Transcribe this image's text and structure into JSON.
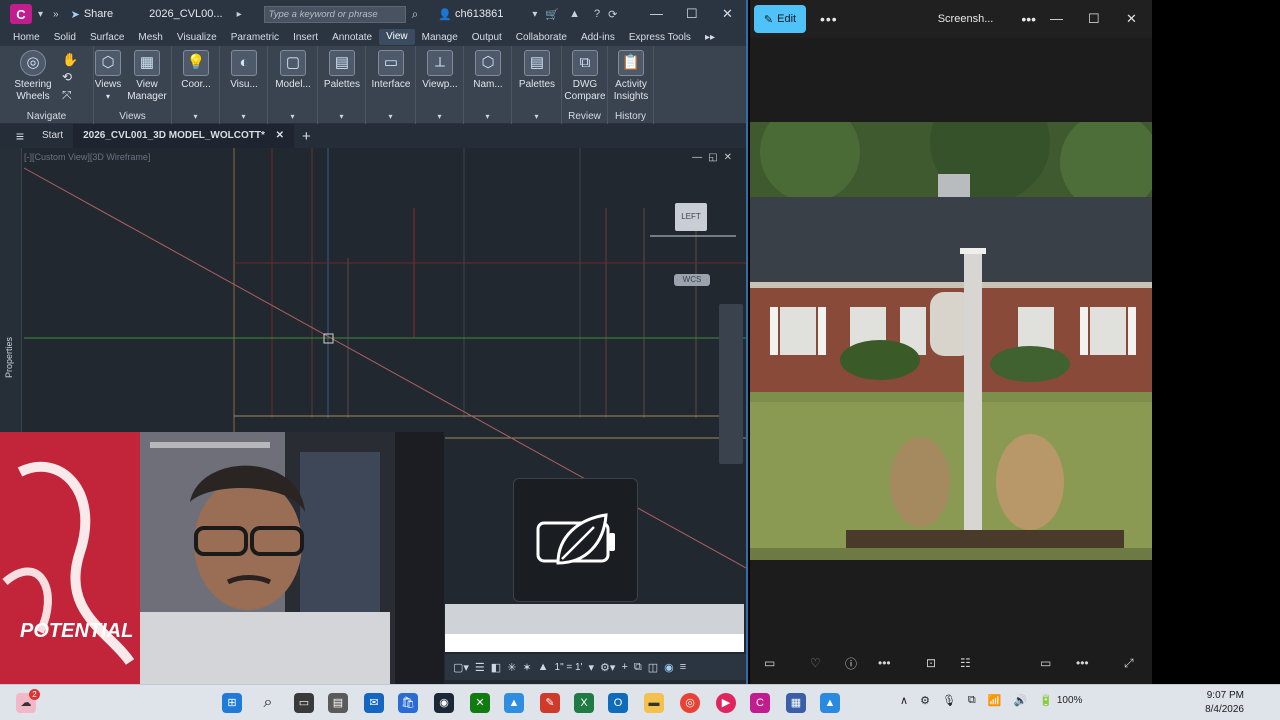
{
  "acad": {
    "app_badge": "C",
    "share_label": "Share",
    "doc_title": "2026_CVL00...",
    "search_placeholder": "Type a keyword or phrase",
    "user": "ch613861",
    "ribbon_tabs": [
      "Home",
      "Solid",
      "Surface",
      "Mesh",
      "Visualize",
      "Parametric",
      "Insert",
      "Annotate",
      "View",
      "Manage",
      "Output",
      "Collaborate",
      "Add-ins",
      "Express Tools"
    ],
    "active_tab": "View",
    "ribbon": {
      "steering_wheels": "Steering\nWheels",
      "navigate_label": "Navigate",
      "views": "Views",
      "view_manager": "View\nManager",
      "views_group": "Views",
      "coor": "Coor...",
      "visu": "Visu...",
      "model": "Model...",
      "palettes1": "Palettes",
      "interface": "Interface",
      "viewp": "Viewp...",
      "nam": "Nam...",
      "palettes2": "Palettes",
      "dwg_compare": "DWG\nCompare",
      "review_label": "Review",
      "activity_insights": "Activity\nInsights",
      "history_label": "History"
    },
    "file_tabs": {
      "start": "Start",
      "active": "2026_CVL001_3D MODEL_WOLCOTT*"
    },
    "viewport_label": "[-][Custom View][3D Wireframe]",
    "viewcube_face": "LEFT",
    "wcs_label": "WCS",
    "properties_label": "Properties",
    "status_scale": "1\" = 1'"
  },
  "photos": {
    "edit_label": "Edit",
    "file_name": "Screensh..."
  },
  "taskbar": {
    "time": "9:07 PM",
    "date": "8/4/2026",
    "battery": "100%",
    "notif_count": "2"
  }
}
